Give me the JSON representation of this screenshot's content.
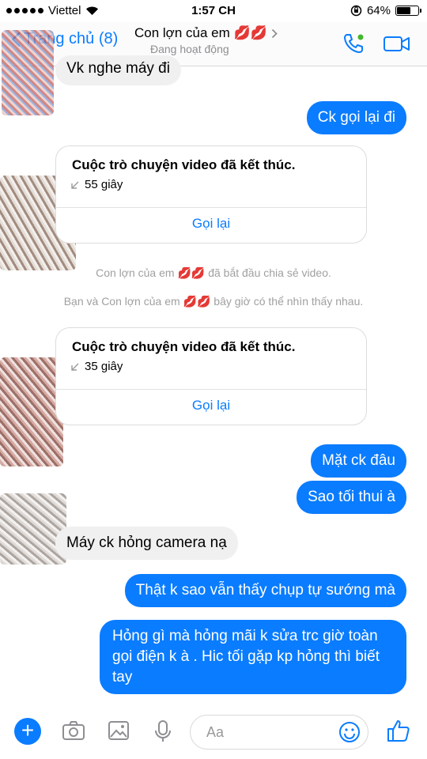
{
  "status_bar": {
    "carrier": "Viettel",
    "time": "1:57 CH",
    "battery": "64%",
    "battery_level": 0.64
  },
  "header": {
    "back_label": "Trang chủ (8)",
    "contact_name": "Con lợn của em 💋💋",
    "contact_status": "Đang hoạt động"
  },
  "messages": {
    "m0": "Vk nghe máy đi",
    "m1": "Ck gọi lại đi",
    "m2": "Mặt ck đâu",
    "m3": "Sao tối thui à",
    "m4": "Máy ck hỏng camera nạ",
    "m5": "Thật k sao vẫn thấy chụp tự sướng mà",
    "m6": "Hỏng gì mà hỏng mãi k sửa trc giờ toàn gọi điện k à . Hic tối gặp kp hỏng thì biết tay"
  },
  "calls": [
    {
      "title": "Cuộc trò chuyện video đã kết thúc.",
      "duration": "55 giây",
      "action": "Gọi lại"
    },
    {
      "title": "Cuộc trò chuyện video đã kết thúc.",
      "duration": "35 giây",
      "action": "Gọi lại"
    }
  ],
  "system_notes": {
    "n1": "Con lợn của em 💋💋 đã bắt đầu chia sẻ video.",
    "n2": "Bạn và Con lợn của em 💋💋 bây giờ có thể nhìn thấy nhau."
  },
  "composer": {
    "placeholder": "Aa",
    "icons": [
      "plus-icon",
      "camera-icon",
      "image-icon",
      "microphone-icon",
      "emoji-icon",
      "thumbs-up-icon"
    ]
  },
  "colors": {
    "accent": "#0a7cff",
    "incoming_bubble": "#f1f0f0"
  }
}
